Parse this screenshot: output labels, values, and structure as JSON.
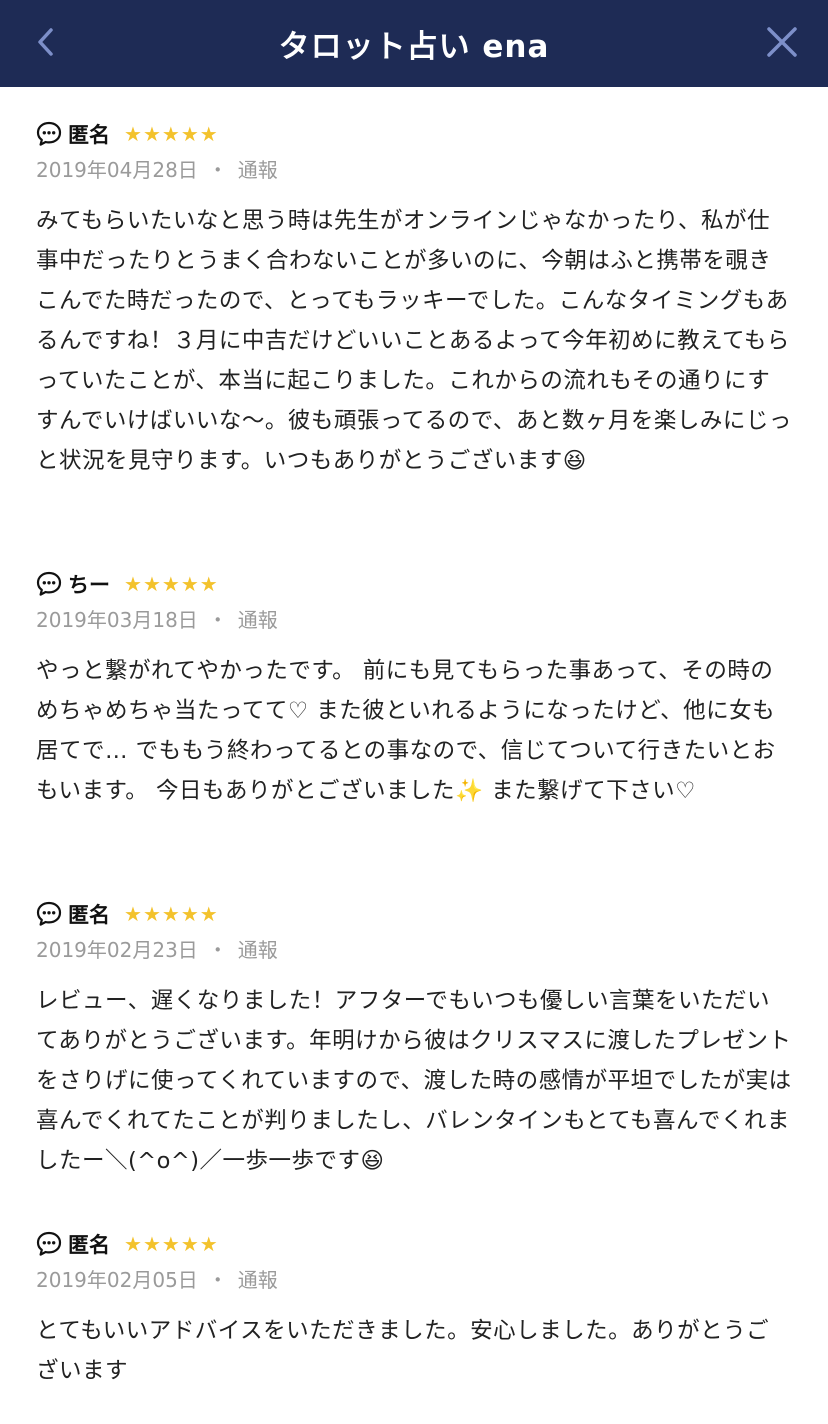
{
  "header": {
    "title": "タロット占い ena",
    "back_icon": "chevron-left-icon",
    "close_icon": "close-icon"
  },
  "colors": {
    "header_bg": "#1e2b55",
    "star": "#f3c22c",
    "meta": "#9a9a9a"
  },
  "reviews": [
    {
      "author": "匿名",
      "rating": 5,
      "date": "2019年04月28日",
      "separator": "・",
      "report_label": "通報",
      "text": "みてもらいたいなと思う時は先生がオンラインじゃなかったり、私が仕事中だったりとうまく合わないことが多いのに、今朝はふと携帯を覗きこんでた時だったので、とってもラッキーでした。こんなタイミングもあるんですね！３月に中吉だけどいいことあるよって今年初めに教えてもらっていたことが、本当に起こりました。これからの流れもその通りにすすんでいけばいいな〜。彼も頑張ってるので、あと数ヶ月を楽しみにじっと状況を見守ります。いつもありがとうございます😆"
    },
    {
      "author": "ちー",
      "rating": 5,
      "date": "2019年03月18日",
      "separator": "・",
      "report_label": "通報",
      "text": "やっと繋がれてやかったです。 前にも見てもらった事あって、その時のめちゃめちゃ当たってて♡ また彼といれるようになったけど、他に女も居てで… でももう終わってるとの事なので、信じてついて行きたいとおもいます。 今日もありがとございました✨ また繋げて下さい♡"
    },
    {
      "author": "匿名",
      "rating": 5,
      "date": "2019年02月23日",
      "separator": "・",
      "report_label": "通報",
      "text": "レビュー、遅くなりました！アフターでもいつも優しい言葉をいただいてありがとうございます。年明けから彼はクリスマスに渡したプレゼントをさりげに使ってくれていますので、渡した時の感情が平坦でしたが実は喜んでくれてたことが判りましたし、バレンタインもとても喜んでくれましたー＼(^o^)／一歩一歩です😆"
    },
    {
      "author": "匿名",
      "rating": 5,
      "date": "2019年02月05日",
      "separator": "・",
      "report_label": "通報",
      "text": "とてもいいアドバイスをいただきました。安心しました。ありがとうございます"
    }
  ]
}
